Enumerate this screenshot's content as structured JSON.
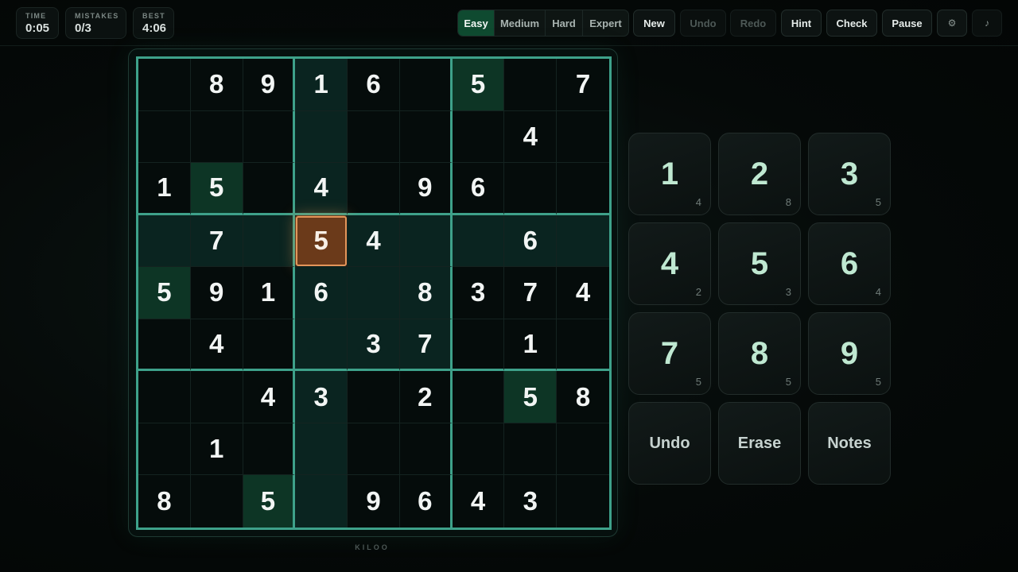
{
  "stats": [
    {
      "label": "TIME",
      "value": "0:05"
    },
    {
      "label": "MISTAKES",
      "value": "0/3"
    },
    {
      "label": "BEST",
      "value": "4:06"
    }
  ],
  "difficulty": {
    "options": [
      "Easy",
      "Medium",
      "Hard",
      "Expert"
    ],
    "selected": "Easy"
  },
  "toolbar": {
    "new_label": "New",
    "undo_label": "Undo",
    "redo_label": "Redo",
    "hint_label": "Hint",
    "check_label": "Check",
    "pause_label": "Pause",
    "settings_icon": "gear-icon",
    "sound_icon": "music-note-icon"
  },
  "board": {
    "rows": [
      [
        "",
        "8",
        "9",
        "1",
        "6",
        "",
        "5",
        "",
        "7"
      ],
      [
        "",
        "",
        "",
        "",
        "",
        "",
        "",
        "4",
        ""
      ],
      [
        "1",
        "5",
        "",
        "4",
        "",
        "9",
        "6",
        "",
        ""
      ],
      [
        "",
        "7",
        "",
        "5",
        "4",
        "",
        "",
        "6",
        ""
      ],
      [
        "5",
        "9",
        "1",
        "6",
        "",
        "8",
        "3",
        "7",
        "4"
      ],
      [
        "",
        "4",
        "",
        "",
        "3",
        "7",
        "",
        "1",
        ""
      ],
      [
        "",
        "",
        "4",
        "3",
        "",
        "2",
        "",
        "5",
        "8"
      ],
      [
        "",
        "1",
        "",
        "",
        "",
        "",
        "",
        "",
        ""
      ],
      [
        "8",
        "",
        "5",
        "",
        "9",
        "6",
        "4",
        "3",
        ""
      ]
    ],
    "selected": {
      "row": 4,
      "col": 4,
      "value": "5"
    },
    "given_color": "#cfd6d4",
    "highlight_color": "#0a2420",
    "same_number_color": "#0d3525",
    "selected_color": "#6b3a1a"
  },
  "keypad": {
    "numbers": [
      {
        "num": "1",
        "count": "4"
      },
      {
        "num": "2",
        "count": "8"
      },
      {
        "num": "3",
        "count": "5"
      },
      {
        "num": "4",
        "count": "2"
      },
      {
        "num": "5",
        "count": "3"
      },
      {
        "num": "6",
        "count": "4"
      },
      {
        "num": "7",
        "count": "5"
      },
      {
        "num": "8",
        "count": "5"
      },
      {
        "num": "9",
        "count": "5"
      }
    ],
    "actions": [
      "Undo",
      "Erase",
      "Notes"
    ]
  },
  "brand": "KILOO"
}
